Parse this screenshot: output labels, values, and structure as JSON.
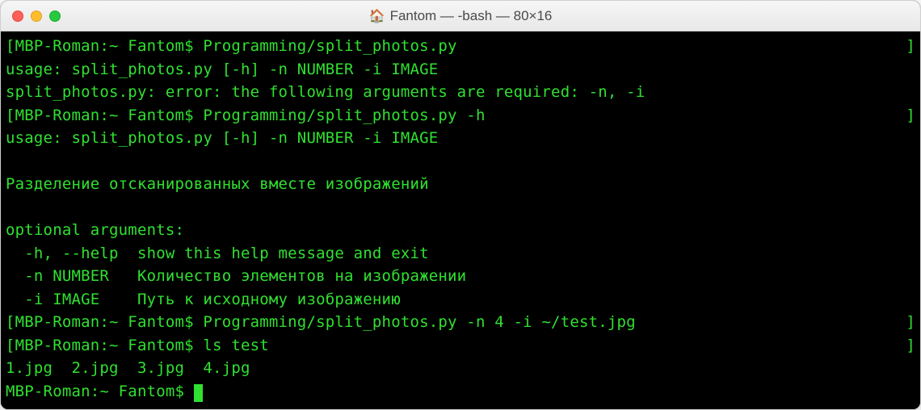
{
  "window": {
    "title": "Fantom — -bash — 80×16",
    "icon": "home-icon"
  },
  "terminal": {
    "lines": [
      {
        "bracketed": true,
        "text": "MBP-Roman:~ Fantom$ Programming/split_photos.py"
      },
      {
        "bracketed": false,
        "text": "usage: split_photos.py [-h] -n NUMBER -i IMAGE"
      },
      {
        "bracketed": false,
        "text": "split_photos.py: error: the following arguments are required: -n, -i"
      },
      {
        "bracketed": true,
        "text": "MBP-Roman:~ Fantom$ Programming/split_photos.py -h"
      },
      {
        "bracketed": false,
        "text": "usage: split_photos.py [-h] -n NUMBER -i IMAGE"
      },
      {
        "bracketed": false,
        "text": ""
      },
      {
        "bracketed": false,
        "text": "Разделение отсканированных вместе изображений"
      },
      {
        "bracketed": false,
        "text": ""
      },
      {
        "bracketed": false,
        "text": "optional arguments:"
      },
      {
        "bracketed": false,
        "text": "  -h, --help  show this help message and exit"
      },
      {
        "bracketed": false,
        "text": "  -n NUMBER   Количество элементов на изображении"
      },
      {
        "bracketed": false,
        "text": "  -i IMAGE    Путь к исходному изображению"
      },
      {
        "bracketed": true,
        "text": "MBP-Roman:~ Fantom$ Programming/split_photos.py -n 4 -i ~/test.jpg"
      },
      {
        "bracketed": true,
        "text": "MBP-Roman:~ Fantom$ ls test"
      },
      {
        "bracketed": false,
        "text": "1.jpg  2.jpg  3.jpg  4.jpg"
      }
    ],
    "prompt": "MBP-Roman:~ Fantom$ "
  }
}
